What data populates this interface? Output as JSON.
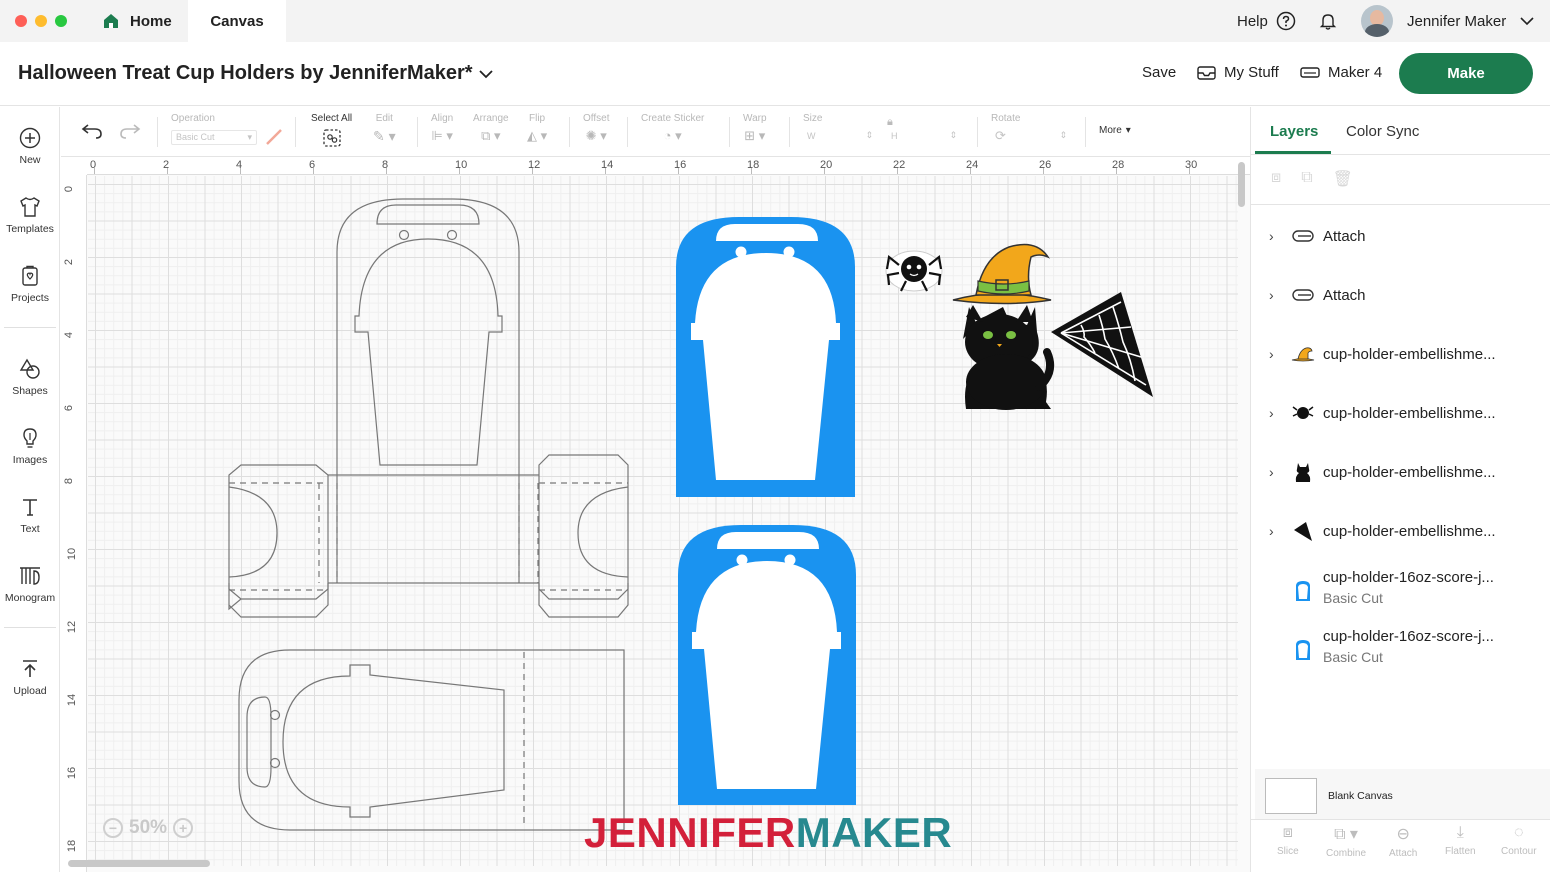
{
  "window": {
    "tabs": [
      {
        "label": "Home"
      },
      {
        "label": "Canvas"
      }
    ],
    "help_label": "Help",
    "user_name": "Jennifer Maker"
  },
  "project": {
    "title": "Halloween Treat Cup Holders by JenniferMaker*",
    "save_label": "Save",
    "my_stuff_label": "My Stuff",
    "machine_label": "Maker 4",
    "make_label": "Make"
  },
  "left_rail": [
    {
      "label": "New",
      "icon": "plus-circle-icon"
    },
    {
      "label": "Templates",
      "icon": "shirt-icon"
    },
    {
      "label": "Projects",
      "icon": "projects-icon"
    },
    {
      "label": "Shapes",
      "icon": "shapes-icon"
    },
    {
      "label": "Images",
      "icon": "lightbulb-icon"
    },
    {
      "label": "Text",
      "icon": "text-icon"
    },
    {
      "label": "Monogram",
      "icon": "monogram-icon"
    },
    {
      "label": "Upload",
      "icon": "upload-icon"
    }
  ],
  "toolbar": {
    "operation_label": "Operation",
    "operation_value": "Basic Cut",
    "select_all_label": "Select All",
    "edit_label": "Edit",
    "align_label": "Align",
    "arrange_label": "Arrange",
    "flip_label": "Flip",
    "offset_label": "Offset",
    "create_sticker_label": "Create Sticker",
    "warp_label": "Warp",
    "size_label": "Size",
    "width_label": "W",
    "height_label": "H",
    "rotate_label": "Rotate",
    "more_label": "More"
  },
  "rulers": {
    "x_ticks": [
      "0",
      "2",
      "4",
      "6",
      "8",
      "10",
      "12",
      "14",
      "16",
      "18",
      "20",
      "22",
      "24",
      "26",
      "28",
      "30"
    ],
    "y_ticks": [
      "0",
      "2",
      "4",
      "6",
      "8",
      "10",
      "12",
      "14",
      "16",
      "18"
    ]
  },
  "canvas": {
    "zoom": "50%",
    "watermark_part1": "JENNIFER",
    "watermark_part2": "MAKER",
    "colors": {
      "cup_blue": "#1a93f0",
      "hat_orange": "#f2a71b",
      "hat_band": "#7ac043",
      "watermark_red": "#d3203a",
      "watermark_teal": "#27898f"
    }
  },
  "layers_panel": {
    "tabs": [
      {
        "label": "Layers"
      },
      {
        "label": "Color Sync"
      }
    ],
    "items": [
      {
        "name": "Attach",
        "sub": "",
        "icon": "attach-icon",
        "expandable": true
      },
      {
        "name": "Attach",
        "sub": "",
        "icon": "attach-icon",
        "expandable": true
      },
      {
        "name": "cup-holder-embellishme...",
        "sub": "",
        "icon": "witch-hat-thumb-icon",
        "expandable": true
      },
      {
        "name": "cup-holder-embellishme...",
        "sub": "",
        "icon": "spider-thumb-icon",
        "expandable": true
      },
      {
        "name": "cup-holder-embellishme...",
        "sub": "",
        "icon": "cat-thumb-icon",
        "expandable": true
      },
      {
        "name": "cup-holder-embellishme...",
        "sub": "",
        "icon": "web-thumb-icon",
        "expandable": true
      },
      {
        "name": "cup-holder-16oz-score-j...",
        "sub": "Basic Cut",
        "icon": "cup-thumb-icon",
        "expandable": false
      },
      {
        "name": "cup-holder-16oz-score-j...",
        "sub": "Basic Cut",
        "icon": "cup-thumb-icon",
        "expandable": false
      }
    ],
    "blank_canvas_label": "Blank Canvas",
    "bottom_tools": [
      {
        "label": "Slice"
      },
      {
        "label": "Combine"
      },
      {
        "label": "Attach"
      },
      {
        "label": "Flatten"
      },
      {
        "label": "Contour"
      }
    ]
  }
}
